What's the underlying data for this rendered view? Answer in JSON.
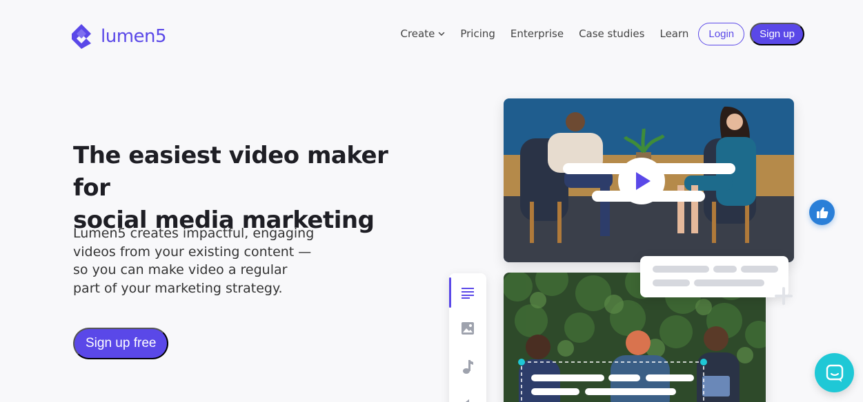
{
  "brand": {
    "name": "lumen5",
    "color": "#5a48e8"
  },
  "nav": {
    "items": [
      {
        "label": "Create"
      },
      {
        "label": "Pricing"
      },
      {
        "label": "Enterprise"
      },
      {
        "label": "Case studies"
      },
      {
        "label": "Learn"
      }
    ],
    "login_label": "Login",
    "signup_label": "Sign up"
  },
  "hero": {
    "title_line1": "The easiest video maker for",
    "title_line2": "social media marketing",
    "desc_line1": "Lumen5 creates impactful, engaging",
    "desc_line2": "videos from your existing content —",
    "desc_line3": "so you can make video a regular",
    "desc_line4": "part of your marketing strategy.",
    "cta_label": "Sign up free"
  },
  "illustration": {
    "icons": [
      "play-icon",
      "text-tool-icon",
      "image-tool-icon",
      "music-tool-icon",
      "move-icon",
      "thumbs-up-icon",
      "chat-icon"
    ],
    "accent_cyan": "#1fc8d6",
    "like_blue": "#2a7fd8"
  }
}
